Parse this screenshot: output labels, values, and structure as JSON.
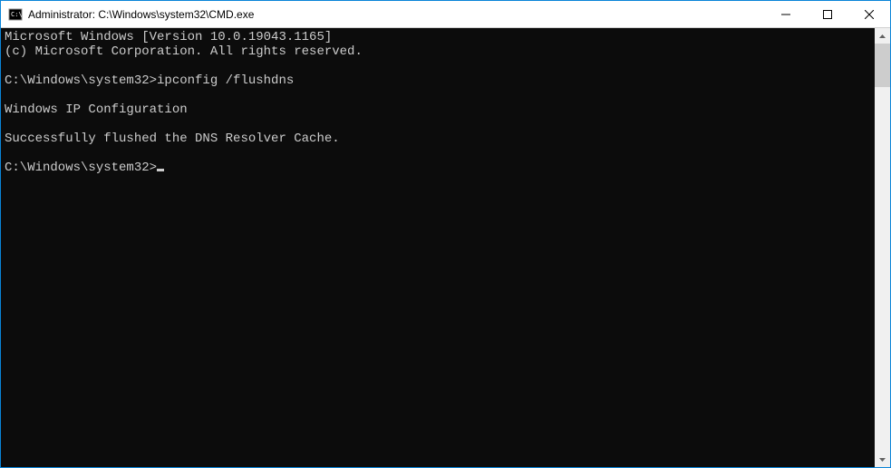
{
  "titlebar": {
    "title": "Administrator: C:\\Windows\\system32\\CMD.exe"
  },
  "console": {
    "lines": [
      "Microsoft Windows [Version 10.0.19043.1165]",
      "(c) Microsoft Corporation. All rights reserved.",
      "",
      "C:\\Windows\\system32>ipconfig /flushdns",
      "",
      "Windows IP Configuration",
      "",
      "Successfully flushed the DNS Resolver Cache.",
      "",
      "C:\\Windows\\system32>"
    ]
  }
}
